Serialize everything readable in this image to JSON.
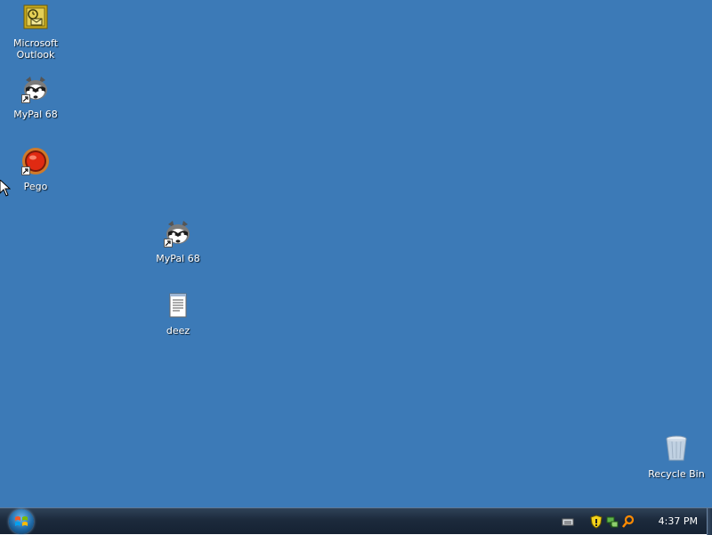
{
  "desktop": {
    "background_color": "#3c7ab7",
    "icons": [
      {
        "id": "outlook",
        "label": "Microsoft Outlook",
        "icon": "outlook-icon",
        "shortcut": false
      },
      {
        "id": "mypal1",
        "label": "MyPal 68",
        "icon": "raccoon-icon",
        "shortcut": true
      },
      {
        "id": "pego",
        "label": "Pego",
        "icon": "red-orb-icon",
        "shortcut": true
      },
      {
        "id": "mypal2",
        "label": "MyPal 68",
        "icon": "raccoon-icon",
        "shortcut": true
      },
      {
        "id": "deez",
        "label": "deez",
        "icon": "text-document-icon",
        "shortcut": false
      },
      {
        "id": "recycle",
        "label": "Recycle Bin",
        "icon": "recycle-bin-icon",
        "shortcut": false
      }
    ]
  },
  "taskbar": {
    "start_button": "windows-orb-icon",
    "tray_icons": [
      "keyboard-icon",
      "security-shield-icon",
      "network-icon",
      "search-icon"
    ],
    "clock": "4:37 PM"
  }
}
